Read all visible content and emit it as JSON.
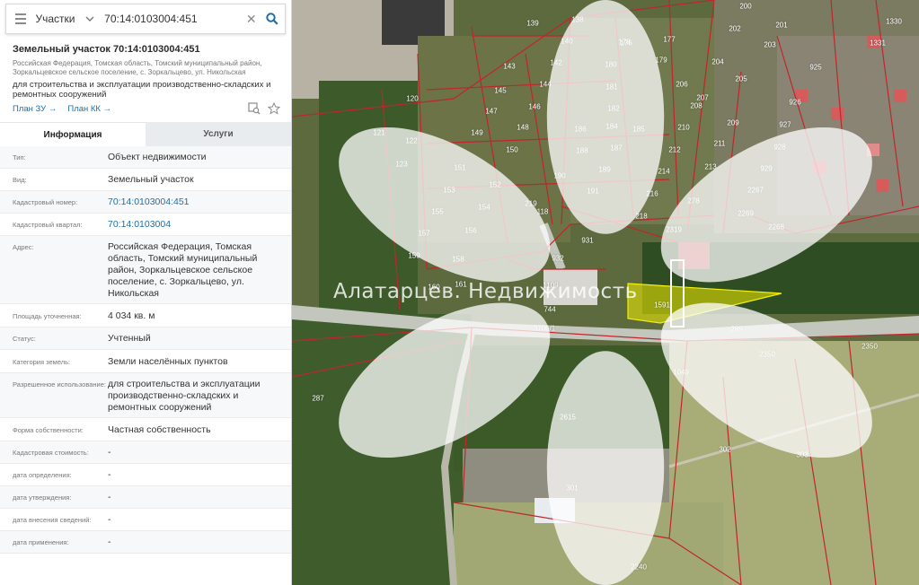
{
  "search": {
    "type_label": "Участки",
    "query": "70:14:0103004:451"
  },
  "object": {
    "title": "Земельный участок 70:14:0103004:451",
    "address_short": "Российская Федерация, Томская область, Томский муниципальный район, Зоркальцевское сельское поселение, с. Зоркальцево, ул. Никольская",
    "purpose": "для строительства и эксплуатации производственно-складских и ремонтных сооружений",
    "link_plan_zu": "План ЗУ →",
    "link_plan_kk": "План КК →"
  },
  "tabs": {
    "info": "Информация",
    "services": "Услуги"
  },
  "details": {
    "type_key": "Тип:",
    "type_val": "Объект недвижимости",
    "kind_key": "Вид:",
    "kind_val": "Земельный участок",
    "cad_num_key": "Кадастровый номер:",
    "cad_num_val": "70:14:0103004:451",
    "cad_q_key": "Кадастровый квартал:",
    "cad_q_val": "70:14:0103004",
    "addr_key": "Адрес:",
    "addr_val": "Российская Федерация, Томская область, Томский муниципальный район, Зоркальцевское сельское поселение, с. Зоркальцево, ул. Никольская",
    "area_key": "Площадь уточненная:",
    "area_val": "4 034 кв. м",
    "status_key": "Статус:",
    "status_val": "Учтенный",
    "category_key": "Категория земель:",
    "category_val": "Земли населённых пунктов",
    "use_key": "Разрешенное использование:",
    "use_val": "для строительства и эксплуатации производственно-складских и ремонтных сооружений",
    "ownership_key": "Форма собственности:",
    "ownership_val": "Частная собственность",
    "cad_cost_key": "Кадастровая стоимость:",
    "cad_cost_val": "-",
    "date_def_key": "дата определения:",
    "date_def_val": "-",
    "date_appr_key": "дата утверждения:",
    "date_appr_val": "-",
    "date_entry_key": "дата внесения сведений:",
    "date_entry_val": "-",
    "date_apply_key": "дата применения:",
    "date_apply_val": "-"
  },
  "map": {
    "watermark": "Алатарцев. Недвижимость",
    "labels": [
      "1330",
      "200",
      "201",
      "139",
      "138",
      "176",
      "177",
      "202",
      "203",
      "140",
      "178",
      "1331",
      "143",
      "142",
      "179",
      "204",
      "925",
      "144",
      "180",
      "205",
      "145",
      "181",
      "206",
      "926",
      "147",
      "146",
      "182",
      "207",
      "208",
      "209",
      "927",
      "184",
      "185",
      "210",
      "120",
      "149",
      "148",
      "186",
      "211",
      "928",
      "121",
      "150",
      "187",
      "212",
      "122",
      "151",
      "188",
      "213",
      "123",
      "152",
      "190",
      "189",
      "214",
      "929",
      "153",
      "154",
      "191",
      "216",
      "2267",
      "118",
      "155",
      "219",
      "218",
      "278",
      "2269",
      "157",
      "156",
      "931",
      "2319",
      "2268",
      "159",
      "932",
      "158",
      "1109",
      "160",
      "161",
      "744",
      "1591",
      "3706/1",
      "289",
      "2350",
      "1049",
      "2350",
      "287",
      "2615",
      "302",
      "303",
      "301",
      "2240"
    ],
    "colors": {
      "boundary": "#c0262b",
      "selected_fill": "#f4f000",
      "road": "#c3c6bd"
    }
  }
}
